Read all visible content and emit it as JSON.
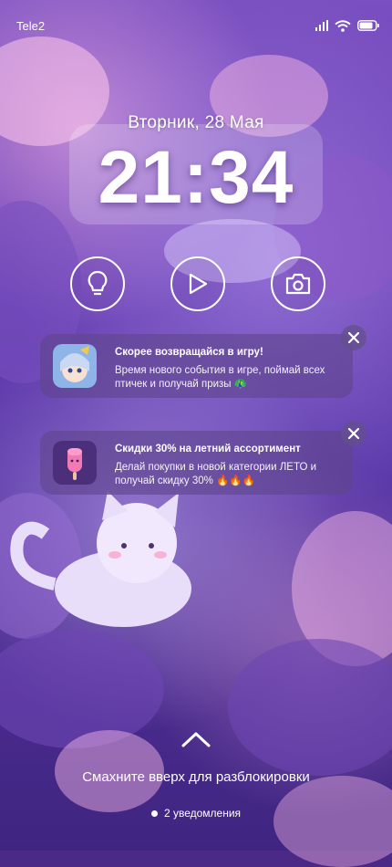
{
  "status_bar": {
    "carrier": "Tele2",
    "icons": [
      "signal-icon",
      "wifi-icon",
      "battery-icon"
    ]
  },
  "lock_screen": {
    "date": "Вторник, 28 Мая",
    "time": "21:34"
  },
  "quick_actions": [
    {
      "name": "flashlight",
      "icon": "lightbulb-icon"
    },
    {
      "name": "play",
      "icon": "play-icon"
    },
    {
      "name": "camera",
      "icon": "camera-icon"
    }
  ],
  "notifications": [
    {
      "title": "Скорее возвращайся в игру!",
      "body": "Время нового события в игре, поймай всех птичек и получай призы 🦚"
    },
    {
      "title": "Скидки 30% на летний ассортимент",
      "body": "Делай покупки в новой категории ЛЕТО и получай скидку 30% 🔥🔥🔥"
    }
  ],
  "unlock": {
    "hint": "Смахните вверх для разблокировки",
    "count_label": "2 уведомления"
  },
  "colors": {
    "wallpaper_base": "#5a38a8",
    "text": "#ffffff",
    "notification_bg": "rgba(95,70,140,0.62)"
  }
}
